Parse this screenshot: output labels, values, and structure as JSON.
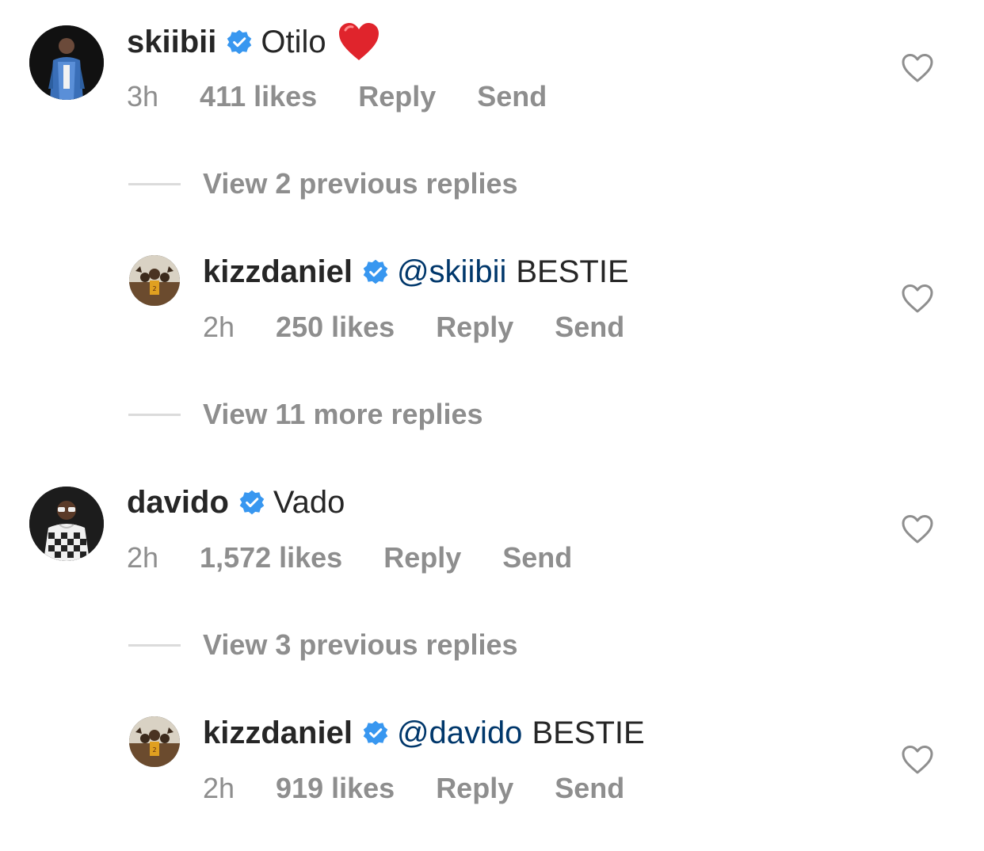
{
  "comments": [
    {
      "username": "skiibii",
      "mention": "",
      "text": "Otilo",
      "emoji": "red-heart",
      "time": "3h",
      "likes": "411 likes",
      "reply": "Reply",
      "send": "Send"
    },
    {
      "username": "kizzdaniel",
      "mention": "@skiibii",
      "text": "BESTIE",
      "time": "2h",
      "likes": "250 likes",
      "reply": "Reply",
      "send": "Send"
    },
    {
      "username": "davido",
      "mention": "",
      "text": "Vado",
      "time": "2h",
      "likes": "1,572 likes",
      "reply": "Reply",
      "send": "Send"
    },
    {
      "username": "kizzdaniel",
      "mention": "@davido",
      "text": "BESTIE",
      "time": "2h",
      "likes": "919 likes",
      "reply": "Reply",
      "send": "Send"
    }
  ],
  "view_replies": [
    "View 2 previous replies",
    "View 11 more replies",
    "View 3 previous replies"
  ],
  "colors": {
    "verified": "#3897f0",
    "mention": "#00376b",
    "secondary_text": "#8e8e8e",
    "divider": "#dbdbdb"
  },
  "icons": {
    "verified": "verified-badge-icon",
    "like": "heart-outline-icon"
  }
}
